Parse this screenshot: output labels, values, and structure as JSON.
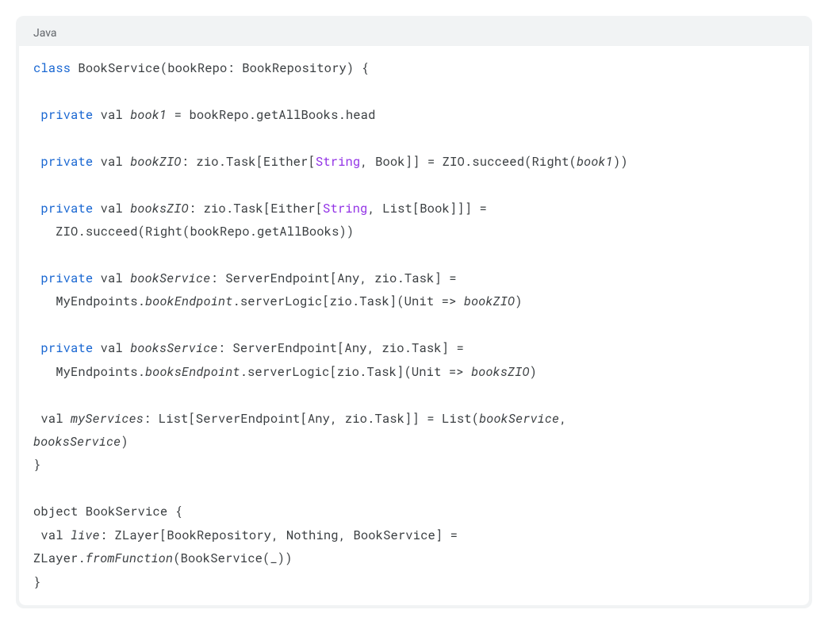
{
  "header": {
    "language_label": "Java"
  },
  "code": {
    "line1": {
      "kw1": "class",
      "rest": " BookService(bookRepo: BookRepository) {"
    },
    "line2": "",
    "line3": {
      "sp": " ",
      "kw": "private",
      "txt1": " val ",
      "it": "book1",
      "txt2": " = bookRepo.getAllBooks.head"
    },
    "line4": "",
    "line5": {
      "sp": " ",
      "kw": "private",
      "txt1": " val ",
      "it1": "bookZIO",
      "txt2": ": zio.Task[Either[",
      "type": "String",
      "txt3": ", Book]] = ZIO.succeed(Right(",
      "it2": "book1",
      "txt4": "))"
    },
    "line6": "",
    "line7": {
      "sp": " ",
      "kw": "private",
      "txt1": " val ",
      "it": "booksZIO",
      "txt2": ": zio.Task[Either[",
      "type": "String",
      "txt3": ", List[Book]]] ="
    },
    "line8": {
      "sp": "   ",
      "txt": "ZIO.succeed(Right(bookRepo.getAllBooks))"
    },
    "line9": "",
    "line10": {
      "sp": " ",
      "kw": "private",
      "txt1": " val ",
      "it": "bookService",
      "txt2": ": ServerEndpoint[Any, zio.Task] ="
    },
    "line11": {
      "sp": "   ",
      "txt1": "MyEndpoints.",
      "it1": "bookEndpoint",
      "txt2": ".serverLogic[zio.Task](Unit => ",
      "it2": "bookZIO",
      "txt3": ")"
    },
    "line12": "",
    "line13": {
      "sp": " ",
      "kw": "private",
      "txt1": " val ",
      "it": "booksService",
      "txt2": ": ServerEndpoint[Any, zio.Task] ="
    },
    "line14": {
      "sp": "   ",
      "txt1": "MyEndpoints.",
      "it1": "booksEndpoint",
      "txt2": ".serverLogic[zio.Task](Unit => ",
      "it2": "booksZIO",
      "txt3": ")"
    },
    "line15": "",
    "line16": {
      "sp": " ",
      "txt1": "val ",
      "it1": "myServices",
      "txt2": ": List[ServerEndpoint[Any, zio.Task]] = List(",
      "it2": "bookService",
      "txt3": ", "
    },
    "line17": {
      "it": "booksService",
      "txt": ")"
    },
    "line18": "}",
    "line19": "",
    "line20": "object BookService {",
    "line21": {
      "sp": " ",
      "txt1": "val ",
      "it": "live",
      "txt2": ": ZLayer[BookRepository, Nothing, BookService] = "
    },
    "line22": {
      "txt1": "ZLayer.",
      "it": "fromFunction",
      "txt2": "(BookService(_))"
    },
    "line23": "}"
  }
}
